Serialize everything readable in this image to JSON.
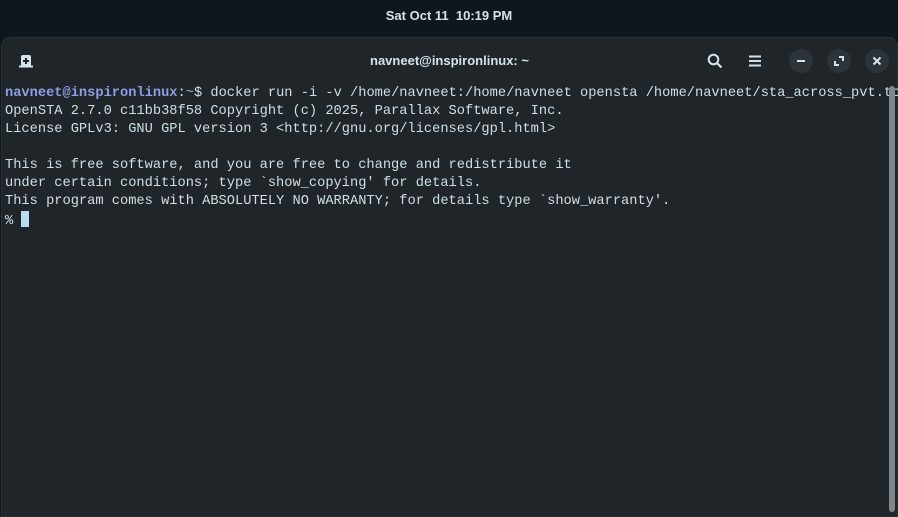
{
  "topbar": {
    "clock": "Sat Oct 11  10:19 PM"
  },
  "window": {
    "title": "navneet@inspironlinux: ~",
    "icons": [
      "new-tab-icon",
      "search-icon",
      "menu-icon",
      "minimize-icon",
      "maximize-icon",
      "close-icon"
    ]
  },
  "terminal": {
    "prompt_user_host": "navneet@inspironlinux",
    "prompt_sep": ":",
    "prompt_path": "~",
    "prompt_symbol": "$ ",
    "command": "docker run -i -v /home/navneet:/home/navneet opensta /home/navneet/sta_across_pvt.tcl",
    "output": [
      "OpenSTA 2.7.0 c11bb38f58 Copyright (c) 2025, Parallax Software, Inc.",
      "License GPLv3: GNU GPL version 3 <http://gnu.org/licenses/gpl.html>",
      "",
      "This is free software, and you are free to change and redistribute it",
      "under certain conditions; type `show_copying' for details.",
      "This program comes with ABSOLUTELY NO WARRANTY; for details type `show_warranty'."
    ],
    "sta_prompt": "% "
  }
}
